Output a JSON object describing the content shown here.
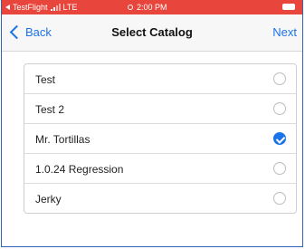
{
  "status_bar": {
    "carrier": "TestFlight",
    "network": "LTE",
    "time": "2:00 PM",
    "signal_bars_filled": 2,
    "signal_bars_total": 4,
    "color": "#e8453c"
  },
  "nav": {
    "back_label": "Back",
    "title": "Select Catalog",
    "next_label": "Next",
    "accent_color": "#1a73e8"
  },
  "catalogs": [
    {
      "label": "Test",
      "selected": false
    },
    {
      "label": "Test 2",
      "selected": false
    },
    {
      "label": "Mr. Tortillas",
      "selected": true
    },
    {
      "label": "1.0.24 Regression",
      "selected": false
    },
    {
      "label": "Jerky",
      "selected": false
    }
  ]
}
